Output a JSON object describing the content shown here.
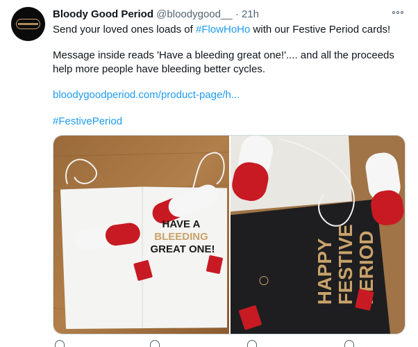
{
  "tweet": {
    "display_name": "Bloody Good Period",
    "handle": "@bloodygood__",
    "separator": "·",
    "time": "21h",
    "line1_prefix": "Send your loved ones loads of ",
    "hashtag1": "#FlowHoHo",
    "line1_suffix": " with our Festive Period cards!",
    "line2": "Message inside reads 'Have a bleeding great one!'.... and all the proceeds",
    "line3": "help more people have bleeding better cycles.",
    "link": "bloodygoodperiod.com/product-page/h...",
    "hashtag2": "#FestivePeriod"
  },
  "photo1": {
    "card_line1": "HAVE A",
    "card_line2": "BLEEDING",
    "card_line3": "GREAT ONE!"
  },
  "photo2": {
    "card_line1": "HAPPY",
    "card_line2": "FESTIVE",
    "card_line3": "PERIOD"
  },
  "colors": {
    "link": "#1d9bf0",
    "secondary_text": "#536471",
    "glitter_red": "#c81a23",
    "card_dark": "#1e1e20",
    "card_gold": "#c9a26a"
  },
  "icons": [
    "more-options-icon",
    "reply-icon",
    "retweet-icon",
    "like-icon",
    "share-icon"
  ]
}
